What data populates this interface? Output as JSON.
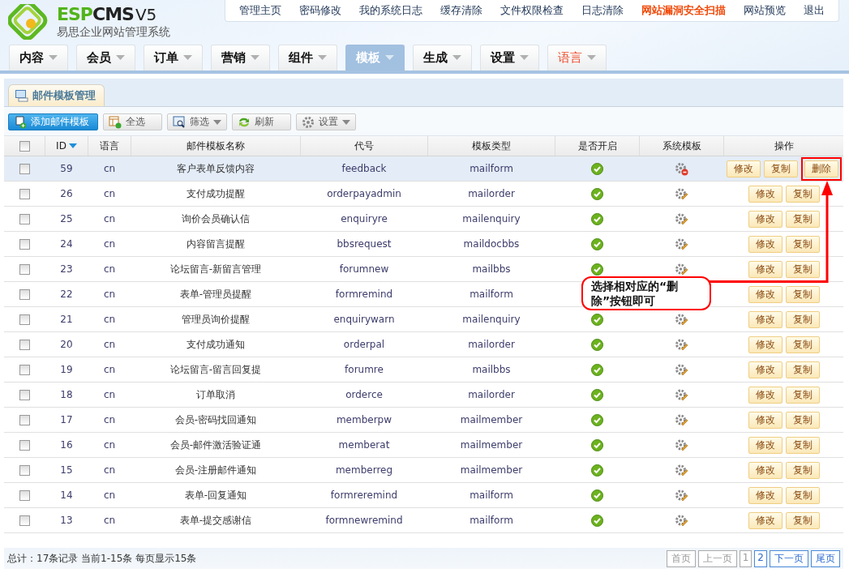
{
  "logo": {
    "brand_green": "ESP",
    "brand_dark": "CMS",
    "version": "V5",
    "subtitle": "易思企业网站管理系统"
  },
  "top_links": [
    {
      "label": "管理主页",
      "highlight": false
    },
    {
      "label": "密码修改",
      "highlight": false
    },
    {
      "label": "我的系统日志",
      "highlight": false
    },
    {
      "label": "缓存清除",
      "highlight": false
    },
    {
      "label": "文件权限检查",
      "highlight": false
    },
    {
      "label": "日志清除",
      "highlight": false
    },
    {
      "label": "网站漏洞安全扫描",
      "highlight": true
    },
    {
      "label": "网站预览",
      "highlight": false
    },
    {
      "label": "退出",
      "highlight": false
    }
  ],
  "nav_tabs": [
    {
      "label": "内容",
      "selected": false,
      "highlight": false
    },
    {
      "label": "会员",
      "selected": false,
      "highlight": false
    },
    {
      "label": "订单",
      "selected": false,
      "highlight": false
    },
    {
      "label": "营销",
      "selected": false,
      "highlight": false
    },
    {
      "label": "组件",
      "selected": false,
      "highlight": false
    },
    {
      "label": "模板",
      "selected": true,
      "highlight": false
    },
    {
      "label": "生成",
      "selected": false,
      "highlight": false
    },
    {
      "label": "设置",
      "selected": false,
      "highlight": false
    },
    {
      "label": "语言",
      "selected": false,
      "highlight": true
    }
  ],
  "panel_tab": "邮件模板管理",
  "toolbar": [
    {
      "label": "添加邮件模板",
      "kind": "add",
      "primary": true,
      "dropdown": false
    },
    {
      "label": "全选",
      "kind": "select-all",
      "primary": false,
      "dropdown": false
    },
    {
      "label": "筛选",
      "kind": "filter",
      "primary": false,
      "dropdown": true
    },
    {
      "label": "刷新",
      "kind": "refresh",
      "primary": false,
      "dropdown": false
    },
    {
      "label": "设置",
      "kind": "settings",
      "primary": false,
      "dropdown": true
    }
  ],
  "table": {
    "select_all_checked": false,
    "columns": [
      {
        "label": "ID",
        "sorted": true
      },
      {
        "label": "语言",
        "sorted": false
      },
      {
        "label": "邮件模板名称",
        "sorted": false
      },
      {
        "label": "代号",
        "sorted": false
      },
      {
        "label": "模板类型",
        "sorted": false
      },
      {
        "label": "是否开启",
        "sorted": false
      },
      {
        "label": "系统模板",
        "sorted": false
      },
      {
        "label": "操作",
        "sorted": false
      }
    ],
    "rows": [
      {
        "id": "59",
        "lang": "cn",
        "name": "客户表单反馈内容",
        "code": "feedback",
        "type": "mailform",
        "enabled": true,
        "system": false,
        "checked": false,
        "selected": true,
        "actions": [
          {
            "label": "修改",
            "highlighted": false
          },
          {
            "label": "复制",
            "highlighted": false
          },
          {
            "label": "删除",
            "highlighted": true
          }
        ]
      },
      {
        "id": "26",
        "lang": "cn",
        "name": "支付成功提醒",
        "code": "orderpayadmin",
        "type": "mailorder",
        "enabled": true,
        "system": true,
        "checked": false,
        "selected": false,
        "actions": [
          {
            "label": "修改",
            "highlighted": false
          },
          {
            "label": "复制",
            "highlighted": false
          }
        ]
      },
      {
        "id": "25",
        "lang": "cn",
        "name": "询价会员确认信",
        "code": "enquiryre",
        "type": "mailenquiry",
        "enabled": true,
        "system": true,
        "checked": false,
        "selected": false,
        "actions": [
          {
            "label": "修改",
            "highlighted": false
          },
          {
            "label": "复制",
            "highlighted": false
          }
        ]
      },
      {
        "id": "24",
        "lang": "cn",
        "name": "内容留言提醒",
        "code": "bbsrequest",
        "type": "maildocbbs",
        "enabled": true,
        "system": true,
        "checked": false,
        "selected": false,
        "actions": [
          {
            "label": "修改",
            "highlighted": false
          },
          {
            "label": "复制",
            "highlighted": false
          }
        ]
      },
      {
        "id": "23",
        "lang": "cn",
        "name": "论坛留言-新留言管理",
        "code": "forumnew",
        "type": "mailbbs",
        "enabled": true,
        "system": true,
        "checked": false,
        "selected": false,
        "actions": [
          {
            "label": "修改",
            "highlighted": false
          },
          {
            "label": "复制",
            "highlighted": false
          }
        ]
      },
      {
        "id": "22",
        "lang": "cn",
        "name": "表单-管理员提醒",
        "code": "formremind",
        "type": "mailform",
        "checked": false,
        "selected": false,
        "actions": [
          {
            "label": "修改",
            "highlighted": false
          },
          {
            "label": "复制",
            "highlighted": false
          }
        ]
      },
      {
        "id": "21",
        "lang": "cn",
        "name": "管理员询价提醒",
        "code": "enquirywarn",
        "type": "mailenquiry",
        "enabled": true,
        "system": true,
        "checked": false,
        "selected": false,
        "actions": [
          {
            "label": "修改",
            "highlighted": false
          },
          {
            "label": "复制",
            "highlighted": false
          }
        ]
      },
      {
        "id": "20",
        "lang": "cn",
        "name": "支付成功通知",
        "code": "orderpal",
        "type": "mailorder",
        "enabled": true,
        "system": true,
        "checked": false,
        "selected": false,
        "actions": [
          {
            "label": "修改",
            "highlighted": false
          },
          {
            "label": "复制",
            "highlighted": false
          }
        ]
      },
      {
        "id": "19",
        "lang": "cn",
        "name": "论坛留言-留言回复提",
        "code": "forumre",
        "type": "mailbbs",
        "enabled": true,
        "system": true,
        "checked": false,
        "selected": false,
        "actions": [
          {
            "label": "修改",
            "highlighted": false
          },
          {
            "label": "复制",
            "highlighted": false
          }
        ]
      },
      {
        "id": "18",
        "lang": "cn",
        "name": "订单取消",
        "code": "orderce",
        "type": "mailorder",
        "enabled": true,
        "system": true,
        "checked": false,
        "selected": false,
        "actions": [
          {
            "label": "修改",
            "highlighted": false
          },
          {
            "label": "复制",
            "highlighted": false
          }
        ]
      },
      {
        "id": "17",
        "lang": "cn",
        "name": "会员-密码找回通知",
        "code": "memberpw",
        "type": "mailmember",
        "enabled": true,
        "system": true,
        "checked": false,
        "selected": false,
        "actions": [
          {
            "label": "修改",
            "highlighted": false
          },
          {
            "label": "复制",
            "highlighted": false
          }
        ]
      },
      {
        "id": "16",
        "lang": "cn",
        "name": "会员-邮件激活验证通",
        "code": "memberat",
        "type": "mailmember",
        "enabled": true,
        "system": true,
        "checked": false,
        "selected": false,
        "actions": [
          {
            "label": "修改",
            "highlighted": false
          },
          {
            "label": "复制",
            "highlighted": false
          }
        ]
      },
      {
        "id": "15",
        "lang": "cn",
        "name": "会员-注册邮件通知",
        "code": "memberreg",
        "type": "mailmember",
        "enabled": true,
        "system": true,
        "checked": false,
        "selected": false,
        "actions": [
          {
            "label": "修改",
            "highlighted": false
          },
          {
            "label": "复制",
            "highlighted": false
          }
        ]
      },
      {
        "id": "14",
        "lang": "cn",
        "name": "表单-回复通知",
        "code": "formreremind",
        "type": "mailform",
        "enabled": true,
        "system": true,
        "checked": false,
        "selected": false,
        "actions": [
          {
            "label": "修改",
            "highlighted": false
          },
          {
            "label": "复制",
            "highlighted": false
          }
        ]
      },
      {
        "id": "13",
        "lang": "cn",
        "name": "表单-提交感谢信",
        "code": "formnewremind",
        "type": "mailform",
        "enabled": true,
        "system": true,
        "checked": false,
        "selected": false,
        "actions": [
          {
            "label": "修改",
            "highlighted": false
          },
          {
            "label": "复制",
            "highlighted": false
          }
        ]
      }
    ]
  },
  "callout": "选择相对应的“删除”按钮即可",
  "footer": {
    "summary": "总计：17条记录 当前1-15条 每页显示15条",
    "pages": [
      {
        "label": "首页",
        "kind": "nav",
        "disabled": true
      },
      {
        "label": "上一页",
        "kind": "nav",
        "disabled": true
      },
      {
        "label": "1",
        "kind": "page",
        "disabled": false,
        "selected": true
      },
      {
        "label": "2",
        "kind": "page",
        "disabled": false,
        "selected": false
      },
      {
        "label": "下一页",
        "kind": "nav",
        "disabled": false
      },
      {
        "label": "尾页",
        "kind": "nav",
        "disabled": false
      }
    ]
  }
}
